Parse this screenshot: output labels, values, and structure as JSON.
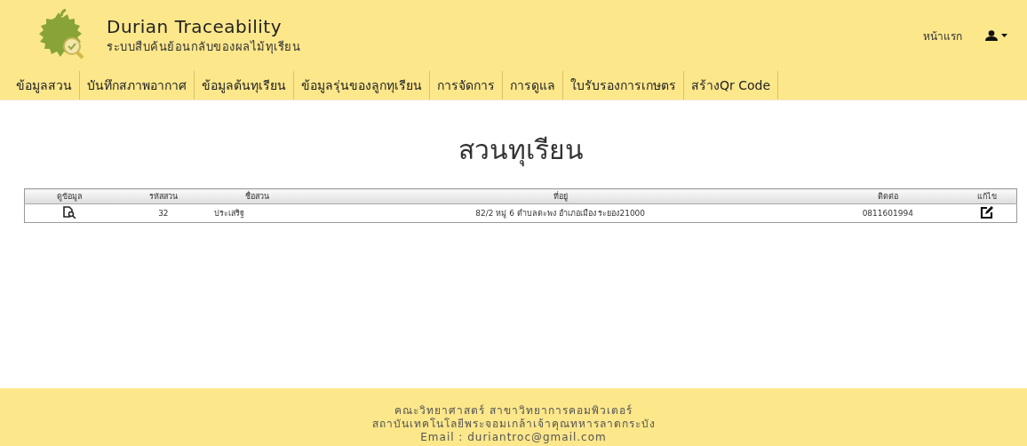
{
  "header": {
    "title": "Durian Traceability",
    "subtitle": "ระบบสืบค้นย้อนกลับของผลไม้ทุเรียน",
    "home_link": "หน้าแรก"
  },
  "nav": {
    "items": [
      "ข้อมูลสวน",
      "บันทึกสภาพอากาศ",
      "ข้อมูลต้นทุเรียน",
      "ข้อมูลรุ่นของลูกทุเรียน",
      "การจัดการ",
      "การดูแล",
      "ใบรับรองการเกษตร",
      "สร้างQr Code"
    ]
  },
  "page_title": "สวนทุเรียน",
  "table": {
    "columns": [
      "ดูข้อมูล",
      "รหัสสวน",
      "ชื่อสวน",
      "ที่อยู่",
      "ติดต่อ",
      "แก้ไข"
    ],
    "rows": [
      {
        "garden_id": "32",
        "name": "ประเสริฐ",
        "address": "82/2 หมู่ 6 ตำบลตะพง อำเภอเมือง ระยอง21000",
        "contact": "0811601994"
      }
    ]
  },
  "footer": {
    "lines": [
      "คณะวิทยาศาสตร์ สาขาวิทยาการคอมพิวเตอร์",
      "สถาบันเทคโนโลยีพระจอมเกล้าเจ้าคุณทหารลาดกระบัง",
      "Email : duriantroc@gmail.com"
    ]
  }
}
